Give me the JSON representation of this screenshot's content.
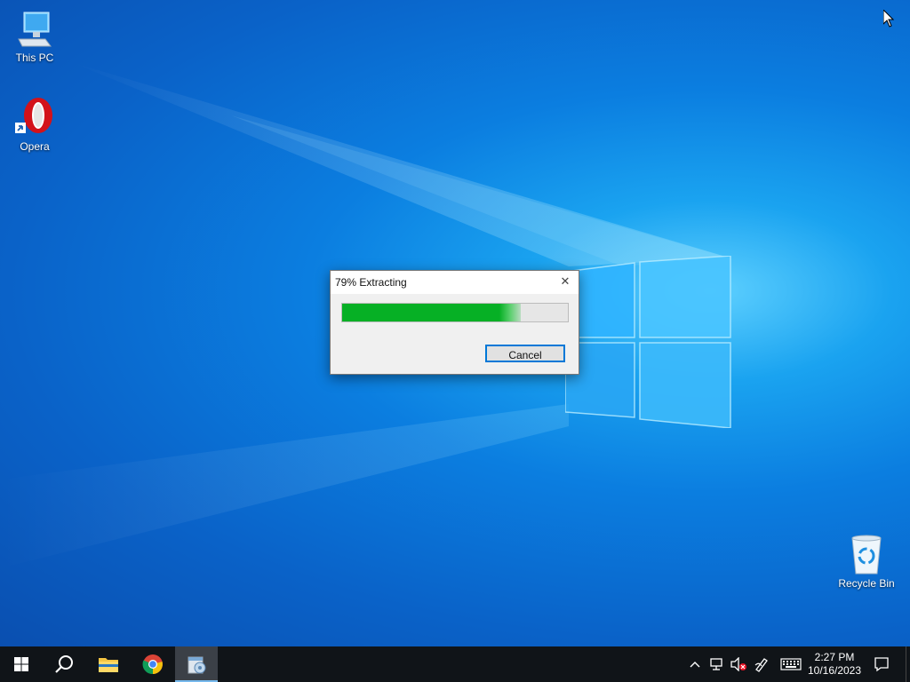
{
  "desktop": {
    "icons": [
      {
        "label": "This PC",
        "icon": "this-pc-icon"
      },
      {
        "label": "Opera",
        "icon": "opera-icon"
      },
      {
        "label": "Recycle Bin",
        "icon": "recycle-bin-icon"
      }
    ]
  },
  "dialog": {
    "title": "79% Extracting",
    "progress_percent": 79,
    "close_icon": "close-icon",
    "cancel_label": "Cancel"
  },
  "taskbar": {
    "items": [
      {
        "name": "start",
        "icon": "windows-start-icon"
      },
      {
        "name": "search",
        "icon": "search-icon"
      },
      {
        "name": "file-explorer",
        "icon": "folder-icon"
      },
      {
        "name": "chrome",
        "icon": "chrome-icon"
      },
      {
        "name": "extractor",
        "icon": "archive-extractor-icon",
        "active": true
      }
    ],
    "tray": {
      "chevron_icon": "chevron-up-icon",
      "network_icon": "network-icon",
      "volume_icon": "volume-muted-icon",
      "pen_icon": "pen-icon",
      "keyboard_icon": "keyboard-icon",
      "time": "2:27 PM",
      "date": "10/16/2023",
      "notification_icon": "notification-icon"
    }
  },
  "colors": {
    "progress_green": "#06b025",
    "taskbar_bg": "#101418",
    "accent": "#0078d7"
  }
}
